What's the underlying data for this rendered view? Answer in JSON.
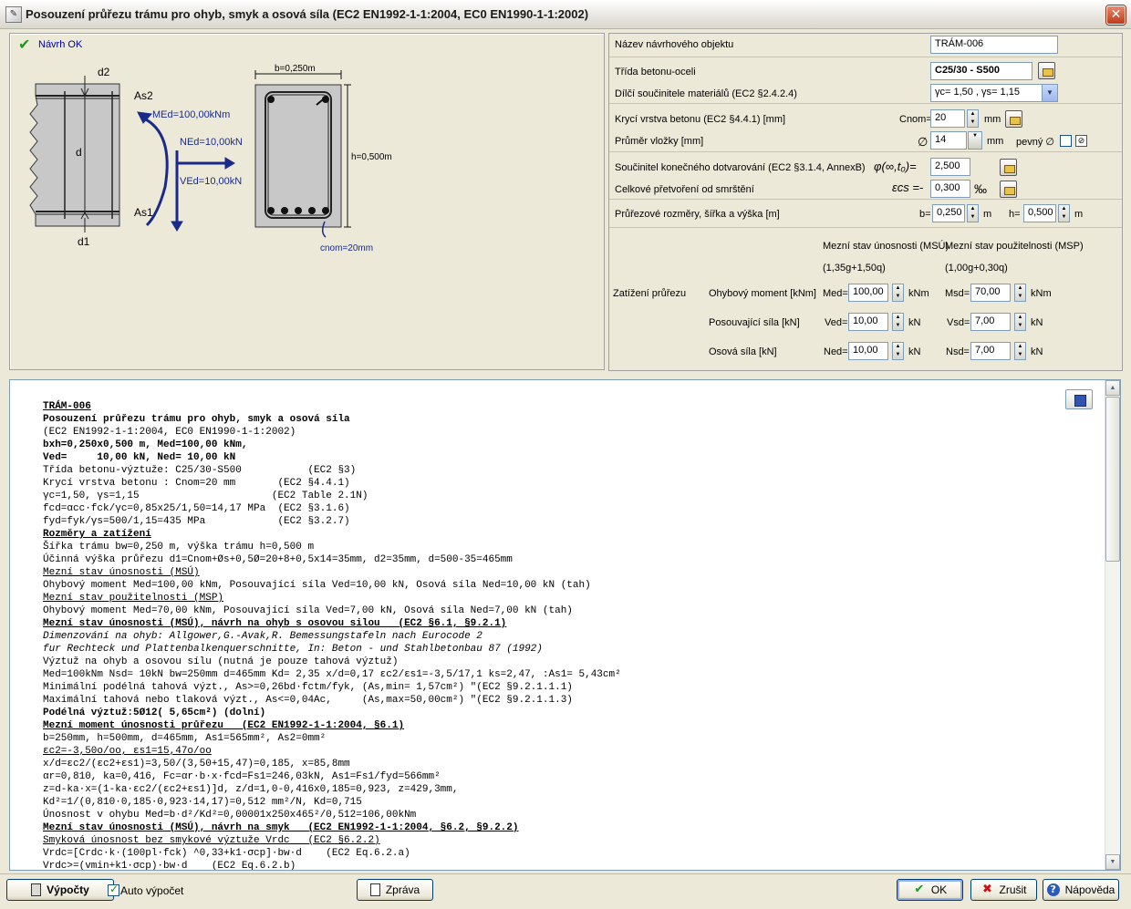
{
  "window": {
    "title": "Posouzení průřezu trámu pro ohyb, smyk a osová síla (EC2 EN1992-1-1:2004, EC0 EN1990-1-1:2002)"
  },
  "status": {
    "text": "Návrh OK"
  },
  "diagram": {
    "d2": "d2",
    "d": "d",
    "d1": "d1",
    "As2": "As2",
    "As1": "As1",
    "MEd": "MEd=100,00kNm",
    "NEd": "NEd=10,00kN",
    "VEd": "VEd=10,00kN",
    "b": "b=0,250m",
    "h": "h=0,500m",
    "cnom": "cnom=20mm"
  },
  "form": {
    "nazev_label": "Název návrhového objektu",
    "nazev_value": "TRÁM-006",
    "trida_label": "Třída betonu-oceli",
    "trida_value": "C25/30 - S500",
    "dilci_label": "Dílčí součinitele materiálů (EC2 §2.4.2.4)",
    "dilci_value": "γc= 1,50 , γs= 1,15",
    "kryci_label": "Krycí vrstva betonu (EC2 §4.4.1) [mm]",
    "cnom_label": "Cnom=",
    "cnom_value": "20",
    "cnom_unit": "mm",
    "prumer_label": "Průměr vložky [mm]",
    "prumer_symbol": "∅",
    "prumer_value": "14",
    "prumer_unit": "mm",
    "pevny_label": "pevný ∅",
    "dotvar_label": "Součinitel konečného dotvarování (EC2 §3.1.4, AnnexB)",
    "dotvar_symbol": "φ(∞,t₀)=",
    "dotvar_value": "2,500",
    "smrst_label": "Celkové přetvoření od smrštění",
    "smrst_symbol": "εcs =-",
    "smrst_value": "0,300",
    "smrst_unit": "‰",
    "rozmery_label": "Průřezové rozměry, šířka a výška [m]",
    "b_label": "b=",
    "b_value": "0,250",
    "b_unit": "m",
    "h_label": "h=",
    "h_value": "0,500",
    "h_unit": "m",
    "msu_header": "Mezní stav únosnosti (MSÚ)",
    "msu_comb": "(1,35g+1,50q)",
    "msp_header": "Mezní stav použitelnosti (MSP)",
    "msp_comb": "(1,00g+0,30q)",
    "zatizeni_label": "Zatížení průřezu",
    "ohyb_label": "Ohybový moment [kNm]",
    "med_label": "Med=",
    "med_value": "100,00",
    "med_unit": "kNm",
    "msd_label": "Msd=",
    "msd_value": "70,00",
    "msd_unit": "kNm",
    "posouv_label": "Posouvající síla [kN]",
    "ved_label": "Ved=",
    "ved_value": "10,00",
    "ved_unit": "kN",
    "vsd_label": "Vsd=",
    "vsd_value": "7,00",
    "vsd_unit": "kN",
    "osova_label": "Osová síla [kN]",
    "ned_label": "Ned=",
    "ned_value": "10,00",
    "ned_unit": "kN",
    "nsd_label": "Nsd=",
    "nsd_value": "7,00",
    "nsd_unit": "kN"
  },
  "report": {
    "lines": [
      {
        "t": "TRÁM-006",
        "s": "bu"
      },
      {
        "t": "Posouzení průřezu trámu pro ohyb, smyk a osová síla",
        "s": "b"
      },
      {
        "t": "(EC2 EN1992-1-1:2004, EC0 EN1990-1-1:2002)",
        "s": ""
      },
      {
        "t": "bxh=0,250x0,500 m, Med=100,00 kNm,",
        "s": "b"
      },
      {
        "t": "Ved=     10,00 kN, Ned= 10,00 kN",
        "s": "b"
      },
      {
        "t": "Třída betonu-výztuže: C25/30-S500           (EC2 §3)",
        "s": ""
      },
      {
        "t": "Krycí vrstva betonu : Cnom=20 mm       (EC2 §4.4.1)",
        "s": ""
      },
      {
        "t": "γc=1,50, γs=1,15                      (EC2 Table 2.1N)",
        "s": ""
      },
      {
        "t": "fcd=αcc·fck/γc=0,85x25/1,50=14,17 MPa  (EC2 §3.1.6)",
        "s": ""
      },
      {
        "t": "fyd=fyk/γs=500/1,15=435 MPa            (EC2 §3.2.7)",
        "s": ""
      },
      {
        "t": "Rozměry a zatížení",
        "s": "bu"
      },
      {
        "t": "Šířka trámu bw=0,250 m, výška trámu h=0,500 m",
        "s": ""
      },
      {
        "t": "Účinná výška průřezu d1=Cnom+Øs+0,5Ø=20+8+0,5x14=35mm, d2=35mm, d=500-35=465mm",
        "s": ""
      },
      {
        "t": "Mezní stav únosnosti (MSÚ)",
        "s": "u"
      },
      {
        "t": "Ohybový moment Med=100,00 kNm, Posouvající síla Ved=10,00 kN, Osová síla Ned=10,00 kN (tah)",
        "s": ""
      },
      {
        "t": "Mezní stav použitelnosti (MSP)",
        "s": "u"
      },
      {
        "t": "Ohybový moment Med=70,00 kNm, Posouvající síla Ved=7,00 kN, Osová síla Ned=7,00 kN (tah)",
        "s": ""
      },
      {
        "t": "Mezní stav únosnosti (MSÚ), návrh na ohyb s osovou silou   (EC2 §6.1, §9.2.1)",
        "s": "bu"
      },
      {
        "t": "Dimenzování na ohyb: Allgower,G.-Avak,R. Bemessungstafeln nach Eurocode 2",
        "s": "i"
      },
      {
        "t": "fur Rechteck und Plattenbalkenquerschnitte, In: Beton - und Stahlbetonbau 87 (1992)",
        "s": "i"
      },
      {
        "t": "Výztuž na ohyb a osovou sílu (nutná je pouze tahová výztuž)",
        "s": ""
      },
      {
        "t": "Med=100kNm Nsd= 10kN bw=250mm d=465mm Kd= 2,35 x/d=0,17 εc2/εs1=-3,5/17,1 ks=2,47, :As1= 5,43cm²",
        "s": ""
      },
      {
        "t": "Minimální podélná tahová výzt., As>=0,26bd·fctm/fyk, (As,min= 1,57cm²) \"(EC2 §9.2.1.1.1)",
        "s": ""
      },
      {
        "t": "Maximální tahová nebo tlaková výzt., As<=0,04Ac,     (As,max=50,00cm²) \"(EC2 §9.2.1.1.3)",
        "s": ""
      },
      {
        "t": "Podélná výztuž:5Ø12( 5,65cm²) (dolní)",
        "s": "b"
      },
      {
        "t": "Mezní moment únosnosti průřezu   (EC2 EN1992-1-1:2004, §6.1)",
        "s": "bu"
      },
      {
        "t": "b=250mm, h=500mm, d=465mm, As1=565mm², As2=0mm²",
        "s": ""
      },
      {
        "t": "εc2=-3,50o/oo, εs1=15,47o/oo",
        "s": "u"
      },
      {
        "t": "x/d=εc2/(εc2+εs1)=3,50/(3,50+15,47)=0,185, x=85,8mm",
        "s": ""
      },
      {
        "t": "αr=0,810, ka=0,416, Fc=αr·b·x·fcd=Fs1=246,03kN, As1=Fs1/fyd=566mm²",
        "s": ""
      },
      {
        "t": "z=d-ka·x=(1-ka·εc2/(εc2+εs1)]d, z/d=1,0-0,416x0,185=0,923, z=429,3mm,",
        "s": ""
      },
      {
        "t": "Kd²=1/(0,810·0,185·0,923·14,17)=0,512 mm²/N, Kd=0,715",
        "s": ""
      },
      {
        "t": "Únosnost v ohybu Med=b·d²/Kd²=0,00001x250x465²/0,512=106,00kNm",
        "s": ""
      },
      {
        "t": "Mezní stav únosnosti (MSÚ), návrh na smyk   (EC2 EN1992-1-1:2004, §6.2, §9.2.2)",
        "s": "bu"
      },
      {
        "t": "Smyková únosnost bez smykové výztuže Vrdc   (EC2 §6.2.2)",
        "s": "u"
      },
      {
        "t": "Vrdc=[Crdc·k·(100pl·fck) ^0,33+k1·σcp]·bw·d    (EC2 Eq.6.2.a)",
        "s": ""
      },
      {
        "t": "Vrdc>=(vmin+k1·σcp)·bw·d    (EC2 Eq.6.2.b)",
        "s": ""
      }
    ]
  },
  "bottom": {
    "vypocty": "Výpočty",
    "auto": "Auto výpočet",
    "zprava": "Zpráva",
    "ok": "OK",
    "zrusit": "Zrušit",
    "napoveda": "Nápověda"
  }
}
